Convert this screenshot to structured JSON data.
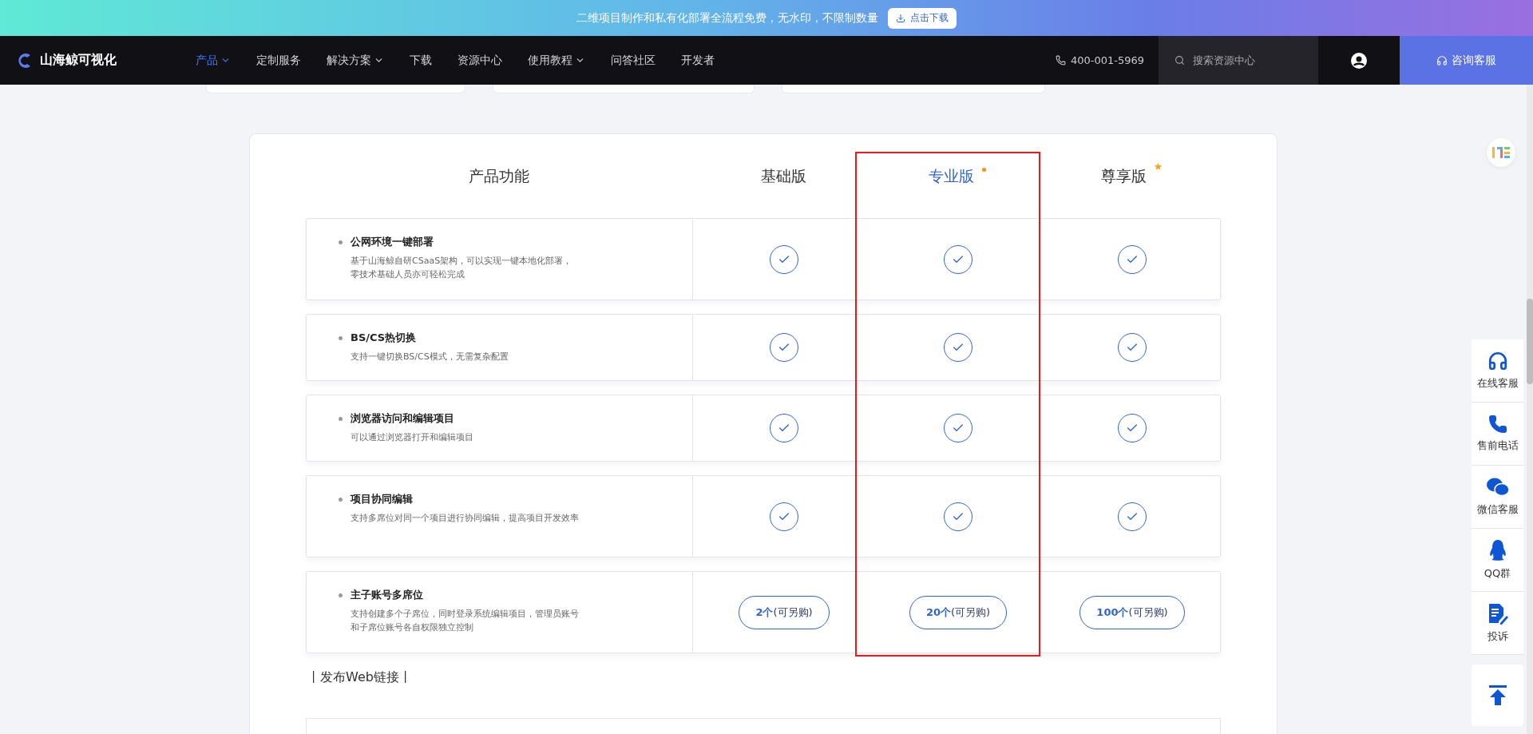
{
  "banner": {
    "text": "二维项目制作和私有化部署全流程免费，无水印，不限制数量",
    "button": "点击下载"
  },
  "nav": {
    "logo": "山海鲸可视化",
    "items": [
      {
        "label": "产品",
        "selected": true,
        "dropdown": true
      },
      {
        "label": "定制服务",
        "selected": false,
        "dropdown": false
      },
      {
        "label": "解决方案",
        "selected": false,
        "dropdown": true
      },
      {
        "label": "下载",
        "selected": false,
        "dropdown": false
      },
      {
        "label": "资源中心",
        "selected": false,
        "dropdown": false
      },
      {
        "label": "使用教程",
        "selected": false,
        "dropdown": true
      },
      {
        "label": "问答社区",
        "selected": false,
        "dropdown": false
      },
      {
        "label": "开发者",
        "selected": false,
        "dropdown": false
      }
    ],
    "phone": "400-001-5969",
    "search": {
      "placeholder": "搜索资源中心"
    },
    "consult": "咨询客服"
  },
  "comparison": {
    "feature_header": "产品功能",
    "plans": [
      {
        "name": "基础版",
        "selected": false,
        "highlighted": false,
        "kind": "plain"
      },
      {
        "name": "专业版",
        "selected": true,
        "highlighted": true,
        "kind": "dot"
      },
      {
        "name": "尊享版",
        "selected": false,
        "highlighted": false,
        "kind": "star"
      }
    ],
    "rows": [
      {
        "title": "公网环境一键部署",
        "description": "基于山海鲸自研CSaaS架构，可以实现一键本地化部署，零技术基础人员亦可轻松完成",
        "cells": [
          {
            "kind": "check"
          },
          {
            "kind": "check"
          },
          {
            "kind": "check"
          }
        ]
      },
      {
        "title": "BS/CS热切换",
        "description": "支持一键切换BS/CS模式，无需复杂配置",
        "cells": [
          {
            "kind": "check"
          },
          {
            "kind": "check"
          },
          {
            "kind": "check"
          }
        ]
      },
      {
        "title": "浏览器访问和编辑项目",
        "description": "可以通过浏览器打开和编辑项目",
        "cells": [
          {
            "kind": "check"
          },
          {
            "kind": "check"
          },
          {
            "kind": "check"
          }
        ]
      },
      {
        "title": "项目协同编辑",
        "description": "支持多席位对同一个项目进行协同编辑，提高项目开发效率",
        "cells": [
          {
            "kind": "check"
          },
          {
            "kind": "check"
          },
          {
            "kind": "check"
          }
        ]
      },
      {
        "title": "主子账号多席位",
        "description": "支持创建多个子席位，同时登录系统编辑项目，管理员账号和子席位账号各自权限独立控制",
        "cells": [
          {
            "kind": "button",
            "label": "**2个**(可另购)"
          },
          {
            "kind": "button",
            "label": "**20个**(可另购)"
          },
          {
            "kind": "button",
            "label": "**100个**(可另购)"
          }
        ]
      }
    ],
    "next_section": "丨发布Web链接丨"
  },
  "sidebar": {
    "items": [
      {
        "label": "在线客服",
        "kind": "headset"
      },
      {
        "label": "售前电话",
        "kind": "phone"
      },
      {
        "label": "微信客服",
        "kind": "chat"
      },
      {
        "label": "QQ群",
        "kind": "penguin"
      },
      {
        "label": "投诉",
        "kind": "document"
      }
    ]
  }
}
